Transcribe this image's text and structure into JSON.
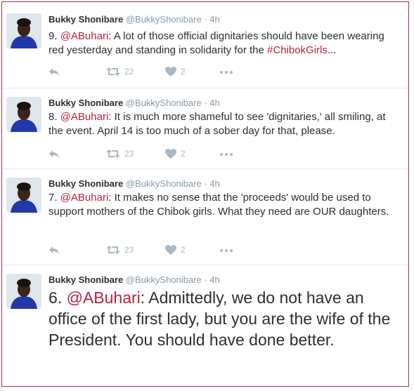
{
  "tweets": [
    {
      "name": "Bukky Shonibare",
      "handle": "@BukkyShonibare",
      "separator": "·",
      "time": "4h",
      "prefix": "9. ",
      "mention": "@ABuhari",
      "body": ": A lot of those official dignitaries should have been wearing red yesterday and standing in solidarity for the ",
      "hashtag": "#ChibokGirls",
      "suffix": "...",
      "retweets": "22",
      "likes": "2"
    },
    {
      "name": "Bukky Shonibare",
      "handle": "@BukkyShonibare",
      "separator": "·",
      "time": "4h",
      "prefix": "8. ",
      "mention": "@ABuhari",
      "body": ": It is much more shameful to see 'dignitaries,' all smiling, at the event. April 14 is too much of a sober day for that, please.",
      "retweets": "23",
      "likes": "2"
    },
    {
      "name": "Bukky Shonibare",
      "handle": "@BukkyShonibare",
      "separator": "·",
      "time": "4h",
      "prefix": "7. ",
      "mention": "@ABuhari",
      "body": ": It makes no sense that the 'proceeds' would be used to support mothers of the Chibok girls. What they need are OUR daughters.",
      "retweets": "23",
      "likes": "2"
    },
    {
      "name": "Bukky Shonibare",
      "handle": "@BukkyShonibare",
      "separator": "·",
      "time": "4h",
      "prefix": "6. ",
      "mention": "@ABuhari",
      "body": ": Admittedly, we do not have an office of the first lady, but you are the wife of the President. You should have done better."
    }
  ],
  "colors": {
    "mention": "#b5233e",
    "muted": "#8899a6",
    "action_icon": "#aab8c2",
    "frame_border": "#a8323a"
  },
  "icons": [
    "reply-icon",
    "retweet-icon",
    "heart-icon",
    "more-icon"
  ]
}
